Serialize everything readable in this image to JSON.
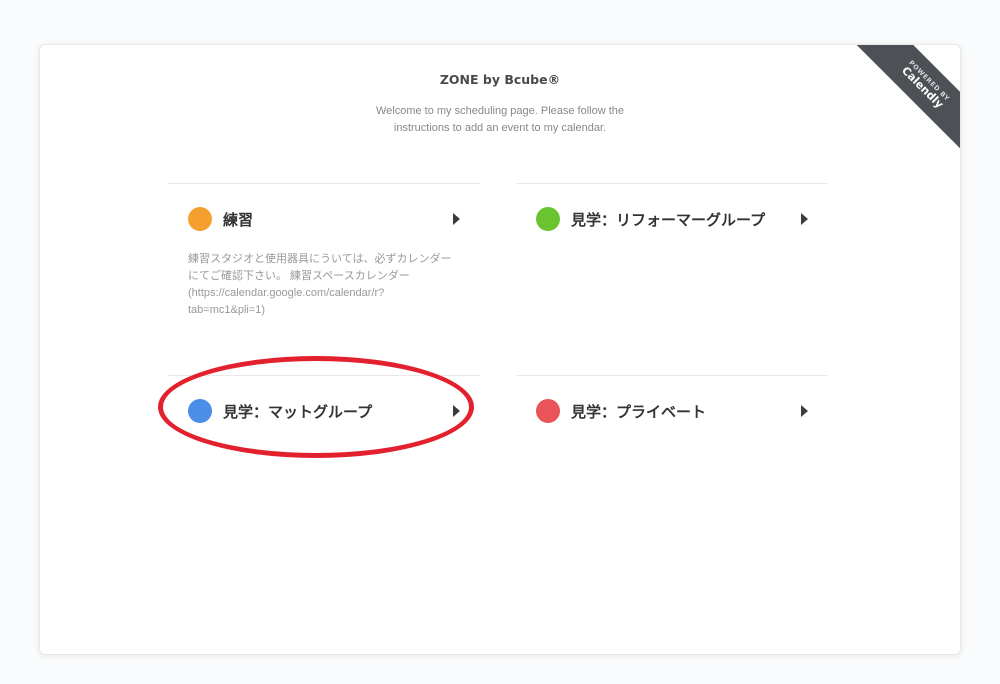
{
  "ribbon": {
    "small": "POWERED BY",
    "big": "Calendly"
  },
  "header": {
    "brand": "ZONE by Bcube®",
    "welcome": "Welcome to my scheduling page. Please follow the instructions to add an event to my calendar."
  },
  "events": [
    {
      "name": "練習",
      "color": "#f5a02e",
      "description": "練習スタジオと使用器具にういては、必ずカレンダーにてご確認下さい。 練習スペースカレンダー (https://calendar.google.com/calendar/r?tab=mc1&pli=1)"
    },
    {
      "name": "見学：リフォーマーグループ",
      "color": "#6ac42f",
      "description": ""
    },
    {
      "name": "見学：マットグループ",
      "color": "#4a8ee8",
      "description": ""
    },
    {
      "name": "見学：プライベート",
      "color": "#e85458",
      "description": ""
    }
  ],
  "annotation": {
    "shape": "ellipse",
    "color": "#e3202d",
    "target": "見学：マットグループ"
  }
}
